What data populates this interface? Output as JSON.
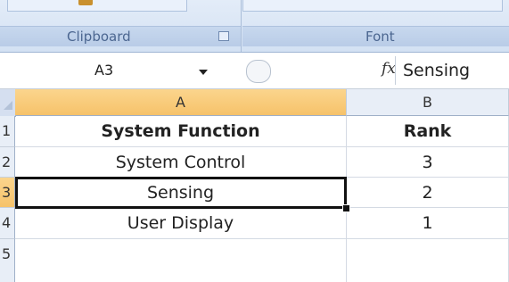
{
  "ribbon": {
    "top_command": "Format Painter",
    "groups": [
      {
        "label": "Clipboard",
        "launcher_icon": "dialog-launcher-icon"
      },
      {
        "label": "Font"
      }
    ]
  },
  "formula_bar": {
    "name_box": "A3",
    "fx_label": "fx",
    "formula_value": "Sensing"
  },
  "sheet": {
    "columns": [
      "A",
      "B"
    ],
    "selected_column": "A",
    "rows": [
      {
        "num": "1",
        "a": "System Function",
        "b": "Rank"
      },
      {
        "num": "2",
        "a": "System Control",
        "b": "3"
      },
      {
        "num": "3",
        "a": "Sensing",
        "b": "2"
      },
      {
        "num": "4",
        "a": "User Display",
        "b": "1"
      },
      {
        "num": "5",
        "a": "",
        "b": ""
      }
    ],
    "active_cell": "A3"
  }
}
